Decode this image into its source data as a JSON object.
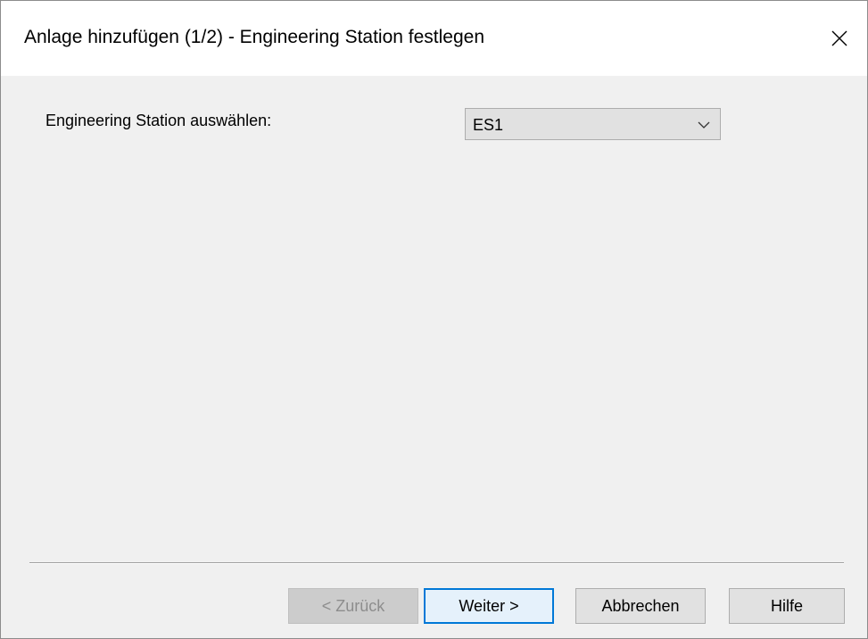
{
  "window": {
    "title": "Anlage hinzufügen (1/2) - Engineering Station festlegen",
    "close_icon": "close-icon"
  },
  "form": {
    "station_label": "Engineering Station auswählen:",
    "station_value": "ES1",
    "dropdown_icon": "chevron-down-icon"
  },
  "buttons": {
    "back_label": "< Zurück",
    "back_enabled": false,
    "next_label": "Weiter >",
    "cancel_label": "Abbrechen",
    "help_label": "Hilfe"
  },
  "colors": {
    "background": "#f0f0f0",
    "titlebar": "#ffffff",
    "default_button_border": "#0078d7",
    "default_button_fill": "#e5f1fb",
    "disabled_text": "#8d8d8d"
  }
}
